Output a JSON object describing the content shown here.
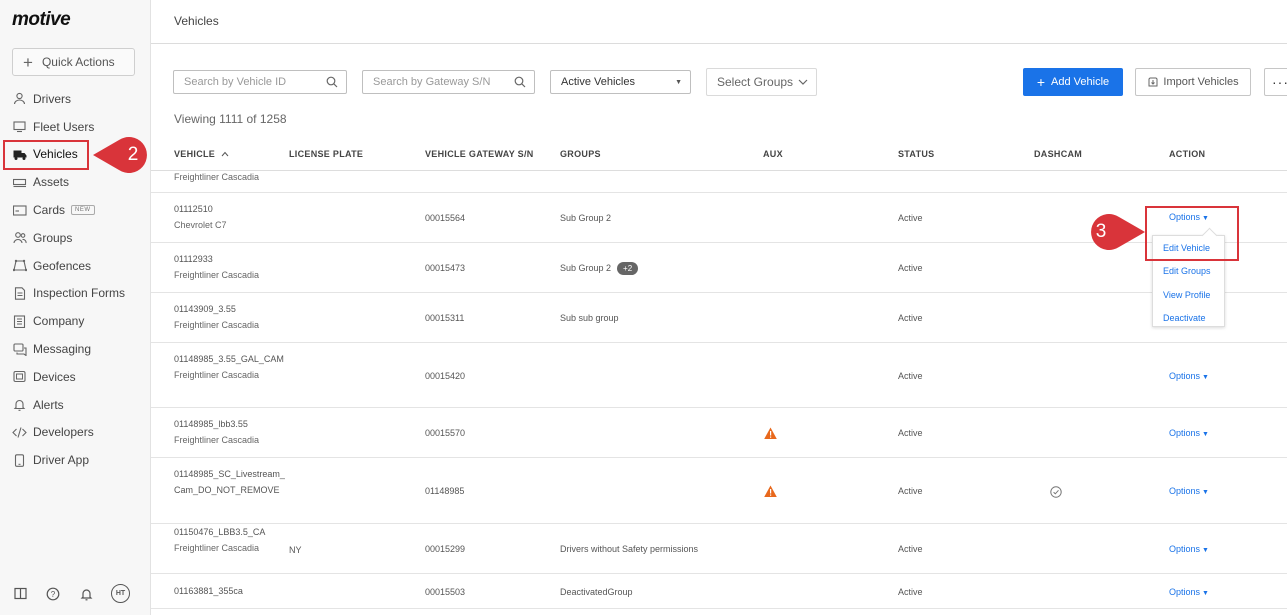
{
  "brand": {
    "logo_text": "motive"
  },
  "sidebar": {
    "quick_actions": "Quick Actions",
    "items": [
      {
        "label": "Drivers",
        "icon": "person-icon"
      },
      {
        "label": "Fleet Users",
        "icon": "monitor-icon"
      },
      {
        "label": "Vehicles",
        "icon": "truck-icon",
        "active": true
      },
      {
        "label": "Assets",
        "icon": "trailer-icon"
      },
      {
        "label": "Cards",
        "icon": "card-icon",
        "badge": "NEW"
      },
      {
        "label": "Groups",
        "icon": "people-icon"
      },
      {
        "label": "Geofences",
        "icon": "geofence-icon"
      },
      {
        "label": "Inspection Forms",
        "icon": "document-icon"
      },
      {
        "label": "Company",
        "icon": "building-icon"
      },
      {
        "label": "Messaging",
        "icon": "chat-icon"
      },
      {
        "label": "Devices",
        "icon": "device-icon"
      },
      {
        "label": "Alerts",
        "icon": "bell-icon"
      },
      {
        "label": "Developers",
        "icon": "code-icon"
      },
      {
        "label": "Driver App",
        "icon": "phone-icon"
      }
    ],
    "avatar_initials": "HT"
  },
  "annotations": {
    "step2": "2",
    "step3": "3",
    "accent_color": "#d9343a"
  },
  "header": {
    "title": "Vehicles"
  },
  "toolbar": {
    "search_vehicle_placeholder": "Search by Vehicle ID",
    "search_gateway_placeholder": "Search by Gateway S/N",
    "status_filter": "Active Vehicles",
    "groups_filter": "Select Groups",
    "add_vehicle": "Add Vehicle",
    "import_vehicles": "Import Vehicles",
    "more": "···",
    "primary_color": "#1a73e8"
  },
  "viewing": "Viewing 1111 of 1258",
  "table": {
    "columns": {
      "vehicle": "VEHICLE",
      "license": "LICENSE PLATE",
      "gateway": "VEHICLE GATEWAY S/N",
      "groups": "GROUPS",
      "aux": "AUX",
      "status": "STATUS",
      "dashcam": "DASHCAM",
      "action": "ACTION"
    },
    "partial_row": {
      "model": "Freightliner Cascadia"
    },
    "rows": [
      {
        "id": "01112510",
        "model": "Chevrolet C7",
        "license": "",
        "gateway": "00015564",
        "groups": "Sub Group 2",
        "extra": "",
        "aux_warning": false,
        "status": "Active",
        "dashcam": false,
        "options": ""
      },
      {
        "id": "01112933",
        "model": "Freightliner Cascadia",
        "license": "",
        "gateway": "00015473",
        "groups": "Sub Group 2",
        "extra": "+2",
        "aux_warning": false,
        "status": "Active",
        "dashcam": false,
        "options": ""
      },
      {
        "id": "01143909_3.55",
        "model": "Freightliner Cascadia",
        "license": "",
        "gateway": "00015311",
        "groups": "Sub sub group",
        "extra": "",
        "aux_warning": false,
        "status": "Active",
        "dashcam": false,
        "options": ""
      },
      {
        "id": "01148985_3.55_GAL_CAM",
        "model": "Freightliner Cascadia",
        "license": "",
        "gateway": "00015420",
        "groups": "",
        "extra": "",
        "aux_warning": false,
        "status": "Active",
        "dashcam": false,
        "options": "Options"
      },
      {
        "id": "01148985_lbb3.55",
        "model": "Freightliner Cascadia",
        "license": "",
        "gateway": "00015570",
        "groups": "",
        "extra": "",
        "aux_warning": true,
        "status": "Active",
        "dashcam": false,
        "options": "Options"
      },
      {
        "id": "01148985_SC_Livestream_Cam_DO_NOT_REMOVE",
        "model": "",
        "license": "",
        "gateway": "01148985",
        "groups": "",
        "extra": "",
        "aux_warning": true,
        "status": "Active",
        "dashcam": true,
        "options": "Options"
      },
      {
        "id": "01150476_LBB3.5_CA",
        "model": "Freightliner Cascadia",
        "license": "NY",
        "gateway": "00015299",
        "groups": "Drivers without Safety permissions",
        "extra": "",
        "aux_warning": false,
        "status": "Active",
        "dashcam": false,
        "options": "Options"
      },
      {
        "id": "01163881_355ca",
        "model": "",
        "license": "",
        "gateway": "00015503",
        "groups": "DeactivatedGroup",
        "extra": "",
        "aux_warning": false,
        "status": "Active",
        "dashcam": false,
        "options": "Options"
      }
    ]
  },
  "open_options": {
    "trigger": "Options",
    "items": [
      "Edit Vehicle",
      "Edit Groups",
      "View Profile",
      "Deactivate"
    ]
  }
}
